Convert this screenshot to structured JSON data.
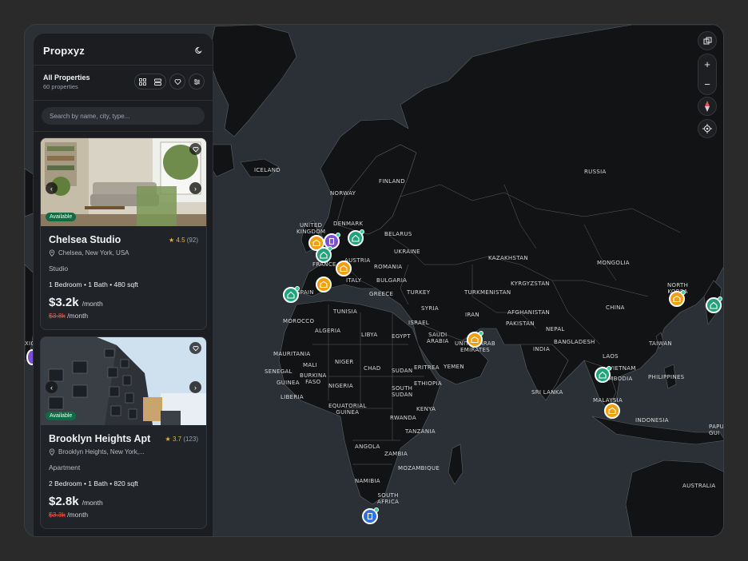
{
  "app": {
    "title": "Propxyz"
  },
  "list_header": {
    "title": "All Properties",
    "count": "60 properties"
  },
  "search": {
    "placeholder": "Search by name, city, type..."
  },
  "cards": [
    {
      "status": "Available",
      "title": "Chelsea Studio",
      "rating": "4.5",
      "reviews": "(92)",
      "location": "Chelsea, New York, USA",
      "type": "Studio",
      "specs": "1 Bedroom • 1 Bath • 480 sqft",
      "price": "$3.2k",
      "price_unit": "/month",
      "old_price": "$3.8k",
      "old_unit": "/month"
    },
    {
      "status": "Available",
      "title": "Brooklyn Heights Apt",
      "rating": "3.7",
      "reviews": "(123)",
      "location": "Brooklyn Heights, New York,...",
      "type": "Apartment",
      "specs": "2 Bedroom • 1 Bath • 820 sqft",
      "price": "$2.8k",
      "price_unit": "/month",
      "old_price": "$3.3k",
      "old_unit": "/month"
    }
  ],
  "map": {
    "labels": {
      "iceland": "ICELAND",
      "norway": "NORWAY",
      "finland": "FINLAND",
      "russia": "RUSSIA",
      "united_kingdom": "UNITED\nKINGDOM",
      "denmark": "DENMARK",
      "belarus": "BELARUS",
      "ukraine": "UKRAINE",
      "france": "FRANCE",
      "austria": "AUSTRIA",
      "italy": "ITALY",
      "romania": "ROMANIA",
      "bulgaria": "BULGARIA",
      "greece": "GREECE",
      "turkey": "TURKEY",
      "spain": "SPAIN",
      "tunisia": "TUNISIA",
      "morocco": "MOROCCO",
      "algeria": "ALGERIA",
      "libya": "LIBYA",
      "egypt": "EGYPT",
      "syria": "SYRIA",
      "israel": "ISRAEL",
      "iran": "IRAN",
      "saudi_arabia": "SAUDI\nARABIA",
      "uae": "UNITED ARAB\nEMIRATES",
      "yemen": "YEMEN",
      "kazakhstan": "KAZAKHSTAN",
      "mongolia": "MONGOLIA",
      "kyrgyzstan": "KYRGYZSTAN",
      "turkmenistan": "TURKMENISTAN",
      "afghanistan": "AFGHANISTAN",
      "pakistan": "PAKISTAN",
      "china": "CHINA",
      "north_korea": "NORTH\nKOREA",
      "nepal": "NEPAL",
      "india": "INDIA",
      "bangladesh": "BANGLADESH",
      "laos": "LAOS",
      "vietnam": "VIETNAM",
      "cambodia": "CAMBODIA",
      "taiwan": "TAIWAN",
      "philippines": "PHILIPPINES",
      "sri_lanka": "SRI LANKA",
      "malaysia": "MALAYSIA",
      "indonesia": "INDONESIA",
      "papua": "PAPU\nGUI",
      "australia": "AUSTRALIA",
      "mauritania": "MAURITANIA",
      "mali": "MALI",
      "niger": "NIGER",
      "chad": "CHAD",
      "sudan": "SUDAN",
      "eritrea": "ERITREA",
      "ethiopia": "ETHIOPIA",
      "senegal": "SENEGAL",
      "guinea": "GUINEA",
      "burkina_faso": "BURKINA\nFASO",
      "nigeria": "NIGERIA",
      "liberia": "LIBERIA",
      "south_sudan": "SOUTH\nSUDAN",
      "equatorial_guinea": "EQUATORIAL\nGUINEA",
      "kenya": "KENYA",
      "rwanda": "RWANDA",
      "tanzania": "TANZANIA",
      "angola": "ANGOLA",
      "zambia": "ZAMBIA",
      "mozambique": "MOZAMBIQUE",
      "namibia": "NAMIBIA",
      "south_africa": "SOUTH\nAFRICA",
      "mexico": "XIC"
    },
    "controls": {
      "zoom_in": "+",
      "zoom_out": "−"
    }
  },
  "colors": {
    "green": "#1fa37a",
    "orange": "#f59e0b",
    "purple": "#7c4dd8",
    "blue": "#2f6fe0"
  }
}
